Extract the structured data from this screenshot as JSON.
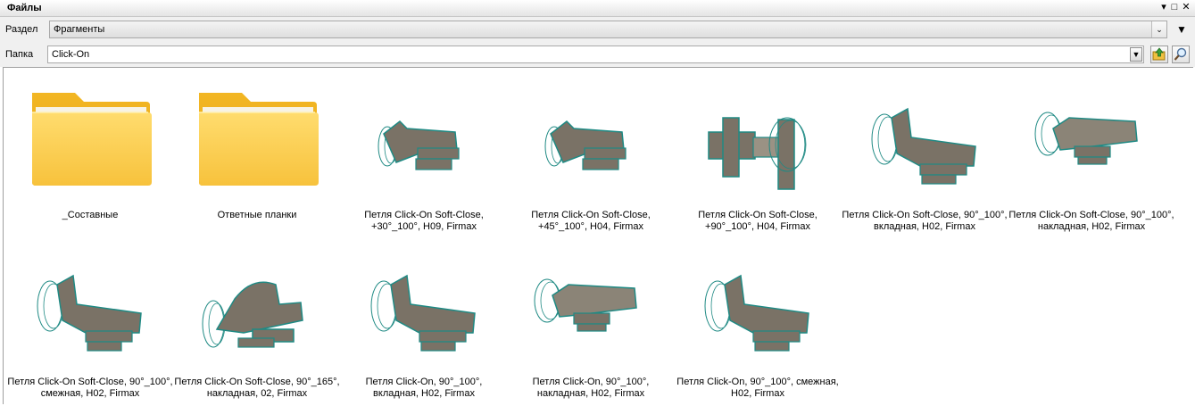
{
  "window": {
    "title": "Файлы"
  },
  "section": {
    "label": "Раздел",
    "value": "Фрагменты"
  },
  "folder": {
    "label": "Папка",
    "value": "Click-On"
  },
  "items": [
    {
      "type": "folder",
      "name": "_Составные"
    },
    {
      "type": "folder",
      "name": "Ответные планки"
    },
    {
      "type": "hinge",
      "name": "Петля Click-On Soft-Close,\n+30°_100°, H09, Firmax",
      "variant": "small-tilt"
    },
    {
      "type": "hinge",
      "name": "Петля Click-On Soft-Close,\n+45°_100°, H04, Firmax",
      "variant": "small-tilt"
    },
    {
      "type": "hinge",
      "name": "Петля Click-On Soft-Close,\n+90°_100°, H04, Firmax",
      "variant": "plate"
    },
    {
      "type": "hinge",
      "name": "Петля Click-On Soft-Close, 90°_100°,\nвкладная, H02, Firmax",
      "variant": "tall"
    },
    {
      "type": "hinge",
      "name": "Петля Click-On Soft-Close, 90°_100°,\nнакладная, H02, Firmax",
      "variant": "flat"
    },
    {
      "type": "hinge",
      "name": "Петля Click-On Soft-Close, 90°_100°,\nсмежная, H02, Firmax",
      "variant": "tall"
    },
    {
      "type": "hinge",
      "name": "Петля Click-On Soft-Close, 90°_165°,\nнакладная, 02, Firmax",
      "variant": "wide"
    },
    {
      "type": "hinge",
      "name": "Петля Click-On, 90°_100°,\nвкладная, H02, Firmax",
      "variant": "tall"
    },
    {
      "type": "hinge",
      "name": "Петля Click-On, 90°_100°,\nнакладная, H02, Firmax",
      "variant": "flat"
    },
    {
      "type": "hinge",
      "name": "Петля Click-On, 90°_100°, смежная,\nH02, Firmax",
      "variant": "tall"
    }
  ],
  "colors": {
    "folder": "#f6c344",
    "hinge_fill": "#7a7266",
    "hinge_edge": "#1f8a84"
  }
}
